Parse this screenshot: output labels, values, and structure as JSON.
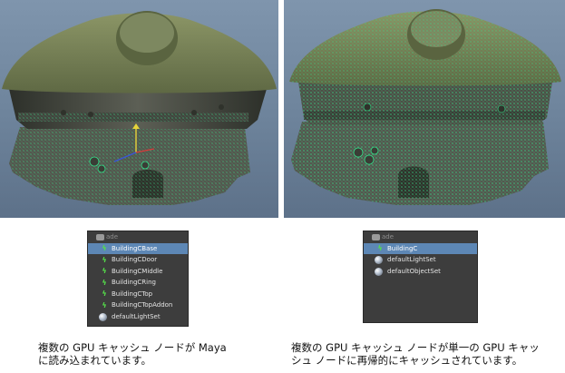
{
  "left_panel": {
    "outliner": {
      "header_label": "ade",
      "items": [
        {
          "label": "BuildingCBase",
          "icon": "gpu-cache-icon",
          "selected": true
        },
        {
          "label": "BuildingCDoor",
          "icon": "gpu-cache-icon",
          "selected": false
        },
        {
          "label": "BuildingCMiddle",
          "icon": "gpu-cache-icon",
          "selected": false
        },
        {
          "label": "BuildingCRing",
          "icon": "gpu-cache-icon",
          "selected": false
        },
        {
          "label": "BuildingCTop",
          "icon": "gpu-cache-icon",
          "selected": false
        },
        {
          "label": "BuildingCTopAddon",
          "icon": "gpu-cache-icon",
          "selected": false
        },
        {
          "label": "defaultLightSet",
          "icon": "set-icon",
          "selected": false
        }
      ]
    },
    "caption_line1": "複数の GPU キャッシュ ノードが Maya",
    "caption_line2": "に読み込まれています。"
  },
  "right_panel": {
    "outliner": {
      "header_label": "ade",
      "items": [
        {
          "label": "BuildingC",
          "icon": "gpu-cache-icon",
          "selected": true
        },
        {
          "label": "defaultLightSet",
          "icon": "set-icon",
          "selected": false
        },
        {
          "label": "defaultObjectSet",
          "icon": "set-icon",
          "selected": false
        }
      ]
    },
    "caption_line1": "複数の GPU キャッシュ ノードが単一の GPU キャッ",
    "caption_line2": "シュ ノードに再帰的にキャッシュされています。"
  },
  "colors": {
    "viewport_bg": "#7189a1",
    "roof": "#6f7a51",
    "wireframe": "#35e08a",
    "outliner_bg": "#3d3d3d",
    "selection": "#5d87b5",
    "gpu_icon": "#55e04a"
  }
}
